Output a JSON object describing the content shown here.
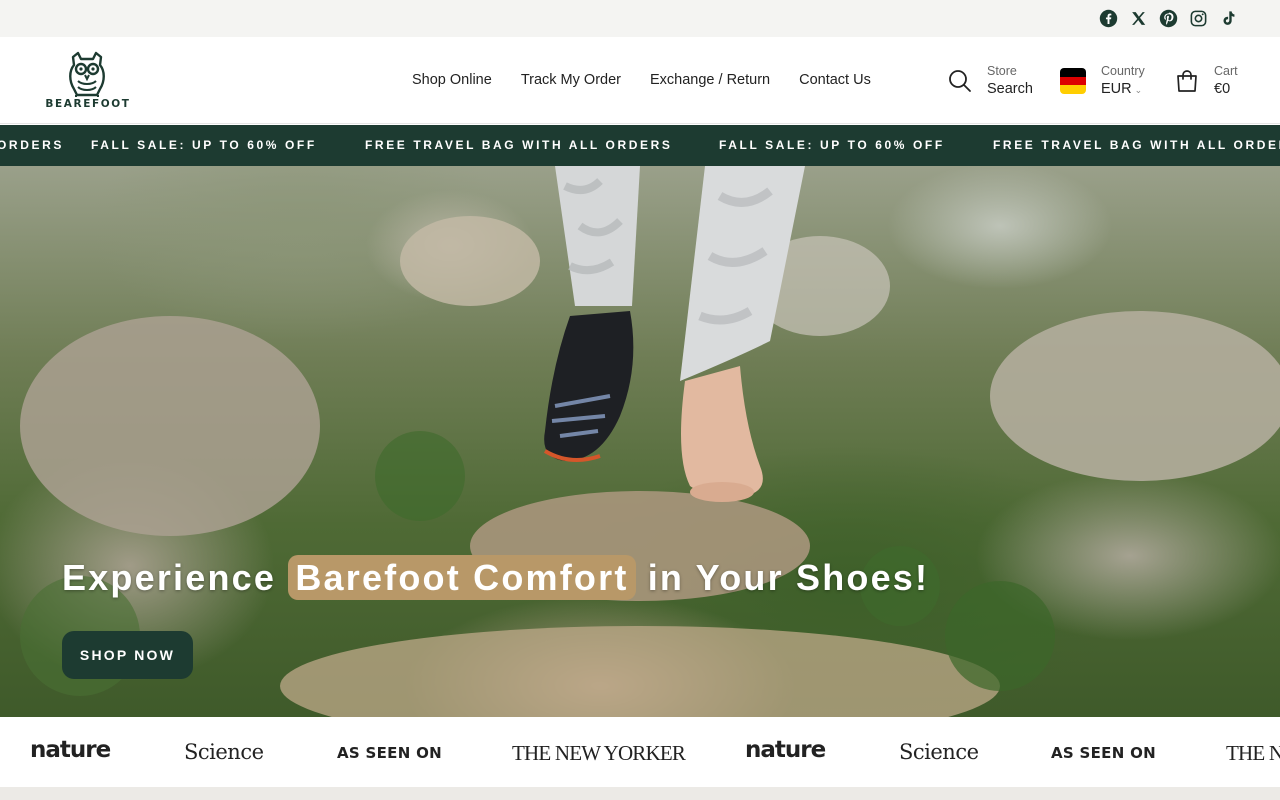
{
  "social": {
    "icons": [
      "facebook-icon",
      "x-twitter-icon",
      "pinterest-icon",
      "instagram-icon",
      "tiktok-icon"
    ]
  },
  "header": {
    "logo_text": "BEAREFOOT",
    "nav": [
      {
        "label": "Shop Online"
      },
      {
        "label": "Track My Order"
      },
      {
        "label": "Exchange / Return"
      },
      {
        "label": "Contact Us"
      }
    ],
    "search": {
      "small": "Store",
      "big": "Search"
    },
    "country": {
      "small": "Country",
      "big": "EUR"
    },
    "cart": {
      "small": "Cart",
      "big": "€0"
    }
  },
  "announcement": {
    "items": [
      "ORDERS",
      "FALL SALE: UP TO 60% OFF",
      "FREE TRAVEL BAG WITH ALL ORDERS",
      "FALL SALE: UP TO 60% OFF",
      "FREE TRAVEL BAG WITH ALL ORDERS"
    ]
  },
  "hero": {
    "title_before": "Experience ",
    "title_highlight": "Barefoot Comfort",
    "title_after": " in Your Shoes!",
    "cta": "SHOP NOW"
  },
  "press": {
    "items": [
      "nature",
      "Science",
      "AS SEEN ON",
      "THE NEW YORKER",
      "nature",
      "Science",
      "AS SEEN ON",
      "THE NE"
    ]
  },
  "colors": {
    "brand_green": "#1d3b31",
    "highlight_tan": "#b89868"
  }
}
